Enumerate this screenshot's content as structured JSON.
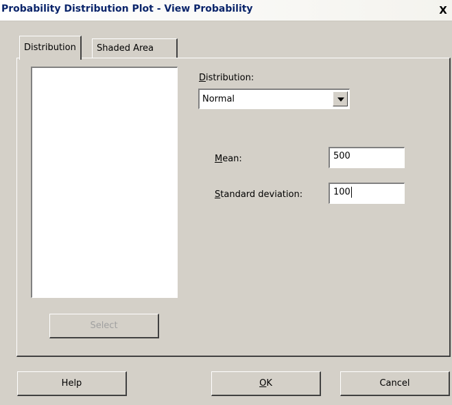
{
  "window": {
    "title": "Probability Distribution Plot - View Probability",
    "close_glyph": "X"
  },
  "tabs": [
    {
      "label": "Distribution",
      "active": true
    },
    {
      "label": "Shaded Area",
      "active": false
    }
  ],
  "variables_list": {
    "items": []
  },
  "select_button": {
    "label": "Select",
    "enabled": false
  },
  "distribution": {
    "label": "Distribution:",
    "value": "Normal"
  },
  "mean": {
    "label": "Mean:",
    "value": "500"
  },
  "std_dev": {
    "label": "Standard deviation:",
    "value": "100"
  },
  "footer": {
    "help": "Help",
    "ok": "OK",
    "cancel": "Cancel"
  }
}
